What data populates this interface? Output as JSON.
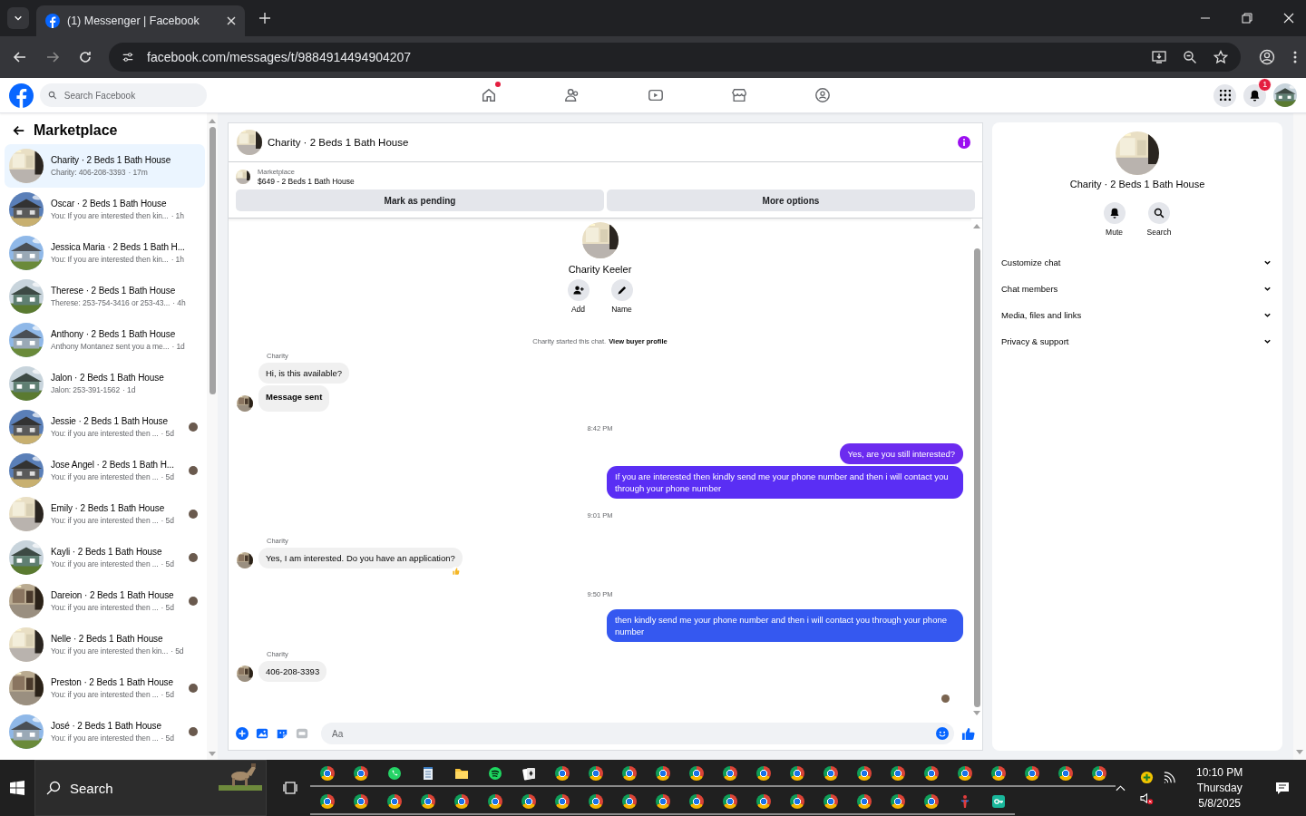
{
  "browser": {
    "tab_title": "(1) Messenger | Facebook",
    "url": "facebook.com/messages/t/9884914494904207"
  },
  "facebook_nav": {
    "search_placeholder": "Search Facebook",
    "nav_items": [
      {
        "kind": "home",
        "dot": true
      },
      {
        "kind": "friends",
        "dot": false
      },
      {
        "kind": "video",
        "dot": false
      },
      {
        "kind": "marketplace",
        "dot": false
      },
      {
        "kind": "groups",
        "dot": false
      }
    ],
    "notification_badge": "1"
  },
  "sidebar": {
    "title": "Marketplace",
    "conversations": [
      {
        "name": "Charity · 2 Beds 1 Bath House",
        "preview": "Charity: 406-208-3393",
        "time": "· 17m",
        "selected": true,
        "seen": false
      },
      {
        "name": "Oscar · 2 Beds 1 Bath House",
        "preview": "You: If you are interested then kin...",
        "time": "· 1h",
        "selected": false,
        "seen": false
      },
      {
        "name": "Jessica Maria · 2 Beds 1 Bath H...",
        "preview": "You: If you are interested then kin...",
        "time": "· 1h",
        "selected": false,
        "seen": false
      },
      {
        "name": "Therese · 2 Beds 1 Bath House",
        "preview": "Therese: 253-754-3416 or 253-43...",
        "time": "· 4h",
        "selected": false,
        "seen": false
      },
      {
        "name": "Anthony · 2 Beds 1 Bath House",
        "preview": "Anthony Montanez sent you a me...",
        "time": "· 1d",
        "selected": false,
        "seen": false
      },
      {
        "name": "Jalon · 2 Beds 1 Bath House",
        "preview": "Jalon: 253-391-1562",
        "time": "· 1d",
        "selected": false,
        "seen": false
      },
      {
        "name": "Jessie · 2 Beds 1 Bath House",
        "preview": "You: if you are interested then ...",
        "time": "· 5d",
        "selected": false,
        "seen": true
      },
      {
        "name": "Jose Angel · 2 Beds 1 Bath H...",
        "preview": "You: if you are interested then ...",
        "time": "· 5d",
        "selected": false,
        "seen": true
      },
      {
        "name": "Emily · 2 Beds 1 Bath House",
        "preview": "You: if you are interested then ...",
        "time": "· 5d",
        "selected": false,
        "seen": true
      },
      {
        "name": "Kayli · 2 Beds 1 Bath House",
        "preview": "You: if you are interested then ...",
        "time": "· 5d",
        "selected": false,
        "seen": true
      },
      {
        "name": "Dareion · 2 Beds 1 Bath House",
        "preview": "You: if you are interested then ...",
        "time": "· 5d",
        "selected": false,
        "seen": true
      },
      {
        "name": "Nelle · 2 Beds 1 Bath House",
        "preview": "You: if you are interested then kin...",
        "time": "· 5d",
        "selected": false,
        "seen": false
      },
      {
        "name": "Preston · 2 Beds 1 Bath House",
        "preview": "You: if you are interested then ...",
        "time": "· 5d",
        "selected": false,
        "seen": true
      },
      {
        "name": "José · 2 Beds 1 Bath House",
        "preview": "You: if you are interested then ...",
        "time": "· 5d",
        "selected": false,
        "seen": true
      }
    ]
  },
  "chat": {
    "title": "Charity · 2 Beds 1 Bath House",
    "listing_label": "Marketplace",
    "listing_title": "$649 - 2 Beds 1 Bath House",
    "buttons": [
      "Mark as pending",
      "More options"
    ],
    "profile_name": "Charity Keeler",
    "profile_actions": [
      {
        "kind": "add",
        "label": "Add"
      },
      {
        "kind": "name",
        "label": "Name"
      }
    ],
    "started_text": "Charity started this chat.",
    "profile_link": "View buyer profile",
    "messages": [
      {
        "kind": "sender",
        "text": "Charity"
      },
      {
        "kind": "in",
        "text": "Hi, is this available?",
        "avatar": false,
        "bold": false,
        "reacted": false
      },
      {
        "kind": "in",
        "text": "Message sent",
        "avatar": true,
        "bold": true,
        "reacted": false
      },
      {
        "kind": "time",
        "text": "8:42 PM"
      },
      {
        "kind": "out",
        "text": "Yes, are you still interested?",
        "color": "#6c2bef"
      },
      {
        "kind": "out",
        "text": "If you are interested then kindly send me your phone number and then i will contact you through your phone number",
        "color": "#5a2ef4"
      },
      {
        "kind": "time",
        "text": "9:01 PM"
      },
      {
        "kind": "sender",
        "text": "Charity"
      },
      {
        "kind": "in",
        "text": "Yes, I am interested. Do you have an application?",
        "avatar": true,
        "bold": false,
        "reacted": true
      },
      {
        "kind": "time",
        "text": "9:50 PM"
      },
      {
        "kind": "out",
        "text": "then kindly send me your phone number and then i will contact you through your phone number",
        "color": "#3558f0"
      },
      {
        "kind": "sender",
        "text": "Charity"
      },
      {
        "kind": "in",
        "text": "406-208-3393",
        "avatar": true,
        "bold": false,
        "reacted": false
      }
    ],
    "seen": true,
    "composer_placeholder": "Aa"
  },
  "details": {
    "title": "Charity · 2 Beds 1 Bath House",
    "actions": [
      {
        "kind": "mute",
        "label": "Mute"
      },
      {
        "kind": "search",
        "label": "Search"
      }
    ],
    "sections": [
      {
        "label": "Customize chat",
        "expanded": false
      },
      {
        "label": "Chat members",
        "expanded": false
      },
      {
        "label": "Media, files and links",
        "expanded": false
      },
      {
        "label": "Privacy & support",
        "expanded": false
      }
    ]
  },
  "taskbar": {
    "search": "Search",
    "time": "10:10 PM",
    "day": "Thursday",
    "date": "5/8/2025"
  }
}
